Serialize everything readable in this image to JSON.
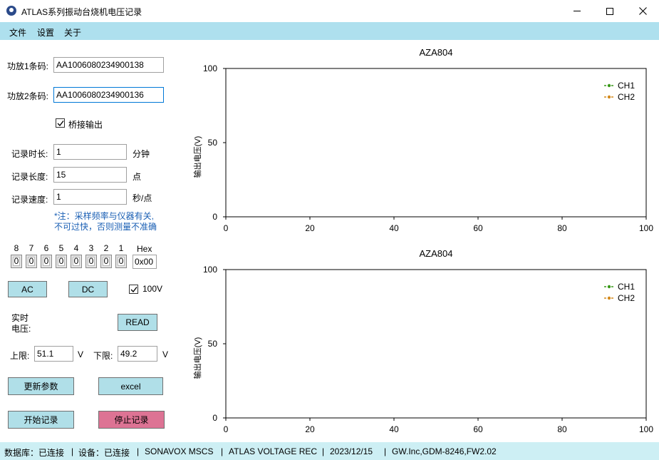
{
  "window": {
    "title": "ATLAS系列振动台烧机电压记录",
    "icon": "app-logo-icon"
  },
  "menu": [
    "文件",
    "设置",
    "关于"
  ],
  "form": {
    "amp1_label": "功放1条码:",
    "amp1_value": "AA1006080234900138",
    "amp2_label": "功放2条码:",
    "amp2_value": "AA1006080234900136",
    "bridge_label": "桥接输出",
    "bridge_checked": true,
    "duration_label": "记录时长:",
    "duration_value": "1",
    "duration_unit": "分钟",
    "length_label": "记录长度:",
    "length_value": "15",
    "length_unit": "点",
    "speed_label": "记录速度:",
    "speed_value": "1",
    "speed_unit": "秒/点",
    "note": "*注：采样频率与仪器有关,\n不可过快，否则测量不准确"
  },
  "bits": {
    "labels": [
      "8",
      "7",
      "6",
      "5",
      "4",
      "3",
      "2",
      "1"
    ],
    "values": [
      "0",
      "0",
      "0",
      "0",
      "0",
      "0",
      "0",
      "0"
    ],
    "hex_label": "Hex",
    "hex_value": "0x00"
  },
  "controls": {
    "ac": "AC",
    "dc": "DC",
    "v100_label": "100V",
    "v100_checked": true,
    "realtime_label": "实时\n电压:",
    "read": "READ",
    "upper_label": "上限:",
    "upper_value": "51.1",
    "upper_unit": "V",
    "lower_label": "下限:",
    "lower_value": "49.2",
    "lower_unit": "V",
    "update": "更新参数",
    "excel": "excel",
    "start": "开始记录",
    "stop": "停止记录"
  },
  "colors": {
    "menubar": "#aee0ee",
    "button": "#b0dfe8",
    "stop_button": "#dd7394",
    "statusbar": "#cdeff4",
    "ch1": "#3a9a1a",
    "ch2": "#d48a1c",
    "note": "#1a5fb4"
  },
  "chart_data": [
    {
      "type": "line",
      "title": "AZA804",
      "xlabel": "",
      "ylabel": "输出电压(V)",
      "xlim": [
        0,
        100
      ],
      "ylim": [
        0,
        100
      ],
      "xticks": [
        0,
        20,
        40,
        60,
        80,
        100
      ],
      "yticks": [
        0,
        50,
        100
      ],
      "grid": false,
      "legend_position": "top-right",
      "series": [
        {
          "name": "CH1",
          "color": "#3a9a1a",
          "x": [],
          "y": []
        },
        {
          "name": "CH2",
          "color": "#d48a1c",
          "x": [],
          "y": []
        }
      ]
    },
    {
      "type": "line",
      "title": "AZA804",
      "xlabel": "",
      "ylabel": "输出电压(V)",
      "xlim": [
        0,
        100
      ],
      "ylim": [
        0,
        100
      ],
      "xticks": [
        0,
        20,
        40,
        60,
        80,
        100
      ],
      "yticks": [
        0,
        50,
        100
      ],
      "grid": false,
      "legend_position": "top-right",
      "series": [
        {
          "name": "CH1",
          "color": "#3a9a1a",
          "x": [],
          "y": []
        },
        {
          "name": "CH2",
          "color": "#d48a1c",
          "x": [],
          "y": []
        }
      ]
    }
  ],
  "status": [
    "数据库：已连接",
    "设备：已连接",
    "SONAVOX MSCS",
    "ATLAS VOLTAGE REC",
    "2023/12/15",
    "GW.Inc,GDM-8246,FW2.02"
  ]
}
